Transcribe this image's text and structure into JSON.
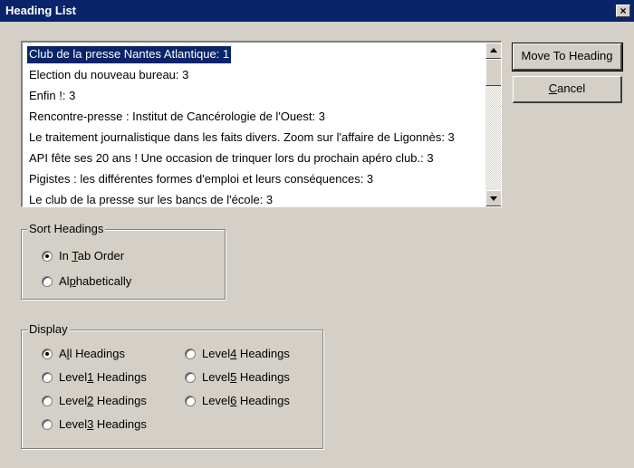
{
  "window": {
    "title": "Heading List",
    "close_glyph": "×"
  },
  "list": {
    "items": [
      "Club de la presse Nantes Atlantique: 1",
      "Election du nouveau bureau: 3",
      "Enfin !: 3",
      "Rencontre-presse : Institut de Cancérologie de l'Ouest: 3",
      "Le traitement journalistique dans les faits divers. Zoom sur l'affaire de Ligonnès: 3",
      "API fête ses 20 ans ! Une occasion de trinquer lors du prochain apéro club.: 3",
      "Pigistes : les différentes formes d'emploi et leurs conséquences: 3",
      "Le club de la presse sur les bancs de l'école: 3"
    ],
    "selected_index": 0
  },
  "buttons": {
    "move_to_heading": "Move To Heading",
    "cancel_pre": "",
    "cancel_key": "C",
    "cancel_post": "ancel"
  },
  "sort": {
    "legend": "Sort Headings",
    "tab_order": {
      "pre": "In ",
      "key": "T",
      "post": "ab Order",
      "checked": true
    },
    "alpha": {
      "pre": "Al",
      "key": "p",
      "post": "habetically",
      "checked": false
    }
  },
  "display": {
    "legend": "Display",
    "all": {
      "pre": "A",
      "key": "l",
      "post": "l Headings",
      "checked": true
    },
    "l1": {
      "pre": "Level",
      "key": "1",
      "post": " Headings",
      "checked": false
    },
    "l2": {
      "pre": "Level",
      "key": "2",
      "post": " Headings",
      "checked": false
    },
    "l3": {
      "pre": "Level",
      "key": "3",
      "post": " Headings",
      "checked": false
    },
    "l4": {
      "pre": "Level",
      "key": "4",
      "post": " Headings",
      "checked": false
    },
    "l5": {
      "pre": "Level",
      "key": "5",
      "post": " Headings",
      "checked": false
    },
    "l6": {
      "pre": "Level",
      "key": "6",
      "post": " Headings",
      "checked": false
    }
  }
}
